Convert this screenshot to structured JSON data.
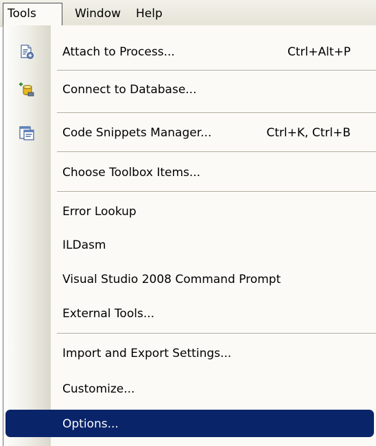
{
  "menubar": {
    "items": [
      {
        "label": "Tools"
      },
      {
        "label": "Window"
      },
      {
        "label": "Help"
      }
    ]
  },
  "tools_menu": {
    "items": [
      {
        "label": "Attach to Process...",
        "shortcut": "Ctrl+Alt+P",
        "icon": "attach-process-icon"
      },
      {
        "label": "Connect to Database...",
        "icon": "connect-database-icon"
      },
      {
        "label": "Code Snippets Manager...",
        "shortcut": "Ctrl+K, Ctrl+B",
        "icon": "code-snippets-icon"
      },
      {
        "label": "Choose Toolbox Items..."
      },
      {
        "label": "Error Lookup"
      },
      {
        "label": "ILDasm"
      },
      {
        "label": "Visual Studio 2008 Command Prompt"
      },
      {
        "label": "External Tools..."
      },
      {
        "label": "Import and Export Settings..."
      },
      {
        "label": "Customize..."
      },
      {
        "label": "Options...",
        "highlighted": true
      }
    ]
  },
  "colors": {
    "highlight": "#0a246a",
    "menu_background": "#fbfaf6"
  }
}
